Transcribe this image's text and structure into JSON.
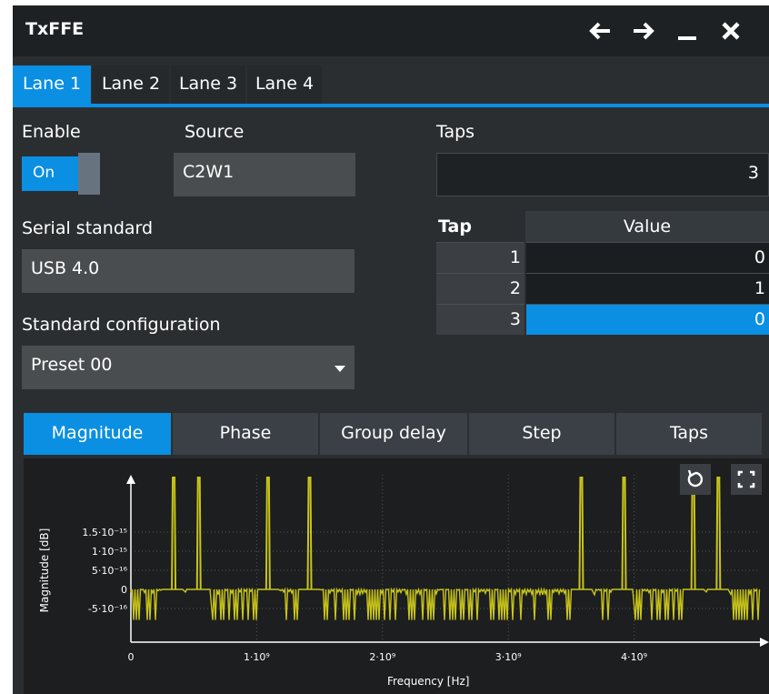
{
  "window": {
    "title": "TxFFE"
  },
  "lane_tabs": [
    {
      "label": "Lane 1",
      "active": true
    },
    {
      "label": "Lane 2",
      "active": false
    },
    {
      "label": "Lane 3",
      "active": false
    },
    {
      "label": "Lane 4",
      "active": false
    }
  ],
  "enable": {
    "label": "Enable",
    "value": "On"
  },
  "source": {
    "label": "Source",
    "value": "C2W1"
  },
  "taps": {
    "label": "Taps",
    "value": "3"
  },
  "serial_standard": {
    "label": "Serial standard",
    "value": "USB 4.0"
  },
  "standard_configuration": {
    "label": "Standard configuration",
    "value": "Preset 00"
  },
  "tap_table": {
    "headers": {
      "tap": "Tap",
      "value": "Value"
    },
    "rows": [
      {
        "tap": "1",
        "value": "0",
        "selected": false
      },
      {
        "tap": "2",
        "value": "1",
        "selected": false
      },
      {
        "tap": "3",
        "value": "0",
        "selected": true
      }
    ]
  },
  "view_tabs": [
    {
      "label": "Magnitude",
      "active": true
    },
    {
      "label": "Phase",
      "active": false
    },
    {
      "label": "Group delay",
      "active": false
    },
    {
      "label": "Step",
      "active": false
    },
    {
      "label": "Taps",
      "active": false
    }
  ],
  "colors": {
    "accent": "#0a8fe3",
    "trace": "#c8c41a",
    "background": "#2b2e31"
  },
  "chart_data": {
    "type": "line",
    "xlabel": "Frequency [Hz]",
    "ylabel": "Magnitude [dB]",
    "x_ticks": [
      "0",
      "1·10⁹",
      "2·10⁹",
      "3·10⁹",
      "4·10⁹"
    ],
    "y_ticks": [
      "1.5·10⁻¹⁵",
      "1·10⁻¹⁵",
      "5·10⁻¹⁶",
      "0",
      "-5·10⁻¹⁶"
    ],
    "xlim": [
      0,
      5000000000
    ],
    "grid": true,
    "spike_frequencies": [
      340000000,
      540000000,
      1090000000,
      1420000000,
      3580000000,
      3920000000,
      4470000000,
      4670000000
    ],
    "noise_band": [
      -8e-16,
      1e-16
    ]
  }
}
